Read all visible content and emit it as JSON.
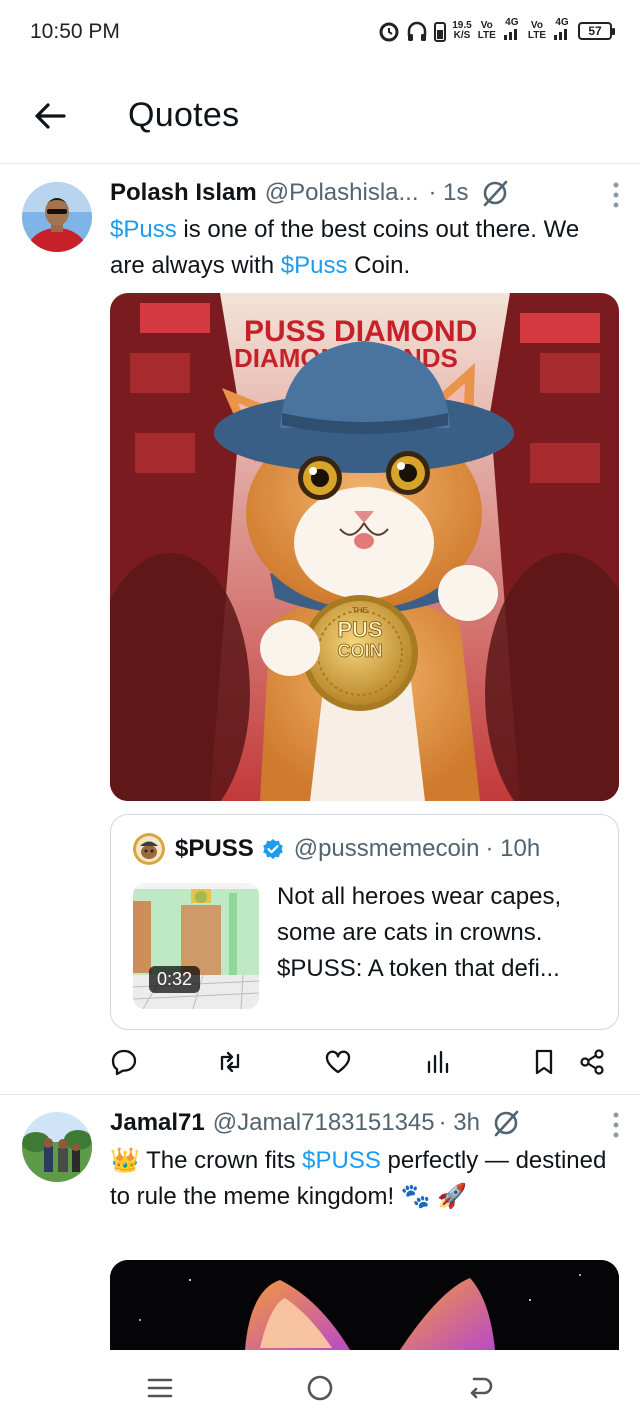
{
  "status_bar": {
    "time": "10:50 PM",
    "speed_value": "19.5",
    "speed_unit": "K/S",
    "sim1_top": "Vo",
    "sim1_bottom": "LTE",
    "sim1_net": "4G",
    "sim2_top": "Vo",
    "sim2_bottom": "LTE",
    "sim2_net": "4G",
    "battery": "57"
  },
  "header": {
    "title": "Quotes"
  },
  "posts": [
    {
      "display_name": "Polash Islam",
      "handle": "@Polashisla...",
      "time": "· 1s",
      "text_parts": [
        "$Puss",
        " is one of the best coins out there. We are always with ",
        "$Puss",
        " Coin."
      ],
      "image_text_line1": "PUSS DIAMOND",
      "image_text_line2": "DIAMOND HANDS",
      "coin_small": "THE",
      "coin_line1": "PUS",
      "coin_line2": "COIN",
      "quote": {
        "display_name": "$PUSS",
        "handle": "@pussmemecoin",
        "time": "· 10h",
        "text": "Not all heroes wear capes, some are cats in crowns. $PUSS: A token that defi...",
        "video_duration": "0:32"
      }
    },
    {
      "display_name": "Jamal71",
      "handle": "@Jamal7183151345",
      "time": "· 3h",
      "text_parts": [
        "👑 The crown fits ",
        "$PUSS",
        " perfectly — destined to rule the meme kingdom! 🐾 🚀"
      ]
    }
  ],
  "colors": {
    "accent": "#1d9bf0",
    "text": "#0f1419",
    "muted": "#536471",
    "border": "#cfd9de"
  },
  "icons": [
    "back-arrow-icon",
    "grok-icon",
    "more-icon",
    "verified-icon",
    "reply-icon",
    "repost-icon",
    "like-icon",
    "views-icon",
    "bookmark-icon",
    "share-icon",
    "menu-icon",
    "home-icon",
    "back-icon"
  ]
}
